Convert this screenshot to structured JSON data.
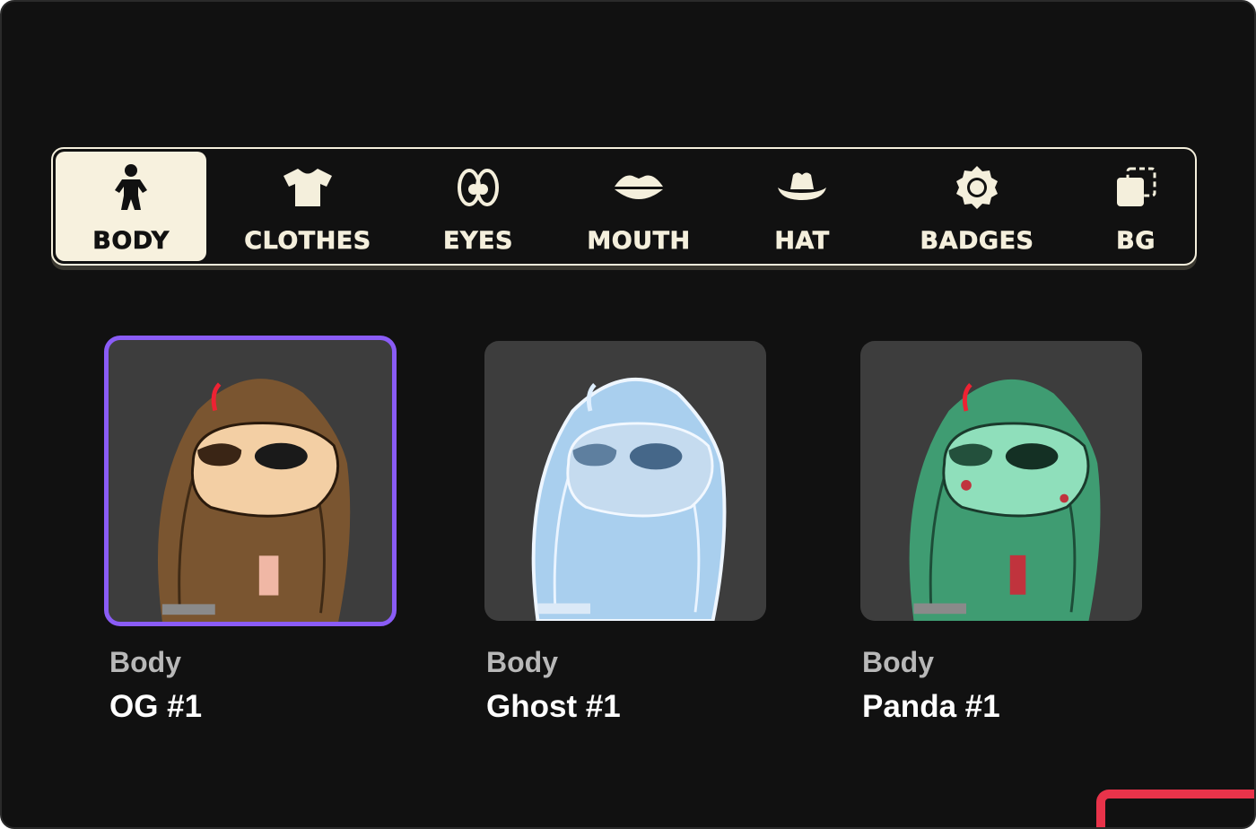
{
  "tabs": [
    {
      "label": "BODY",
      "icon": "person-icon",
      "active": true
    },
    {
      "label": "CLOTHES",
      "icon": "tshirt-icon",
      "active": false
    },
    {
      "label": "EYES",
      "icon": "eyes-icon",
      "active": false
    },
    {
      "label": "MOUTH",
      "icon": "lips-icon",
      "active": false
    },
    {
      "label": "HAT",
      "icon": "cowboy-hat-icon",
      "active": false
    },
    {
      "label": "BADGES",
      "icon": "badge-icon",
      "active": false
    },
    {
      "label": "BG",
      "icon": "background-layer-icon",
      "active": false
    }
  ],
  "items": [
    {
      "category": "Body",
      "name": "OG #1",
      "selected": true,
      "fur_color": "#7a5530",
      "face_color": "#f3cfa4"
    },
    {
      "category": "Body",
      "name": "Ghost #1",
      "selected": false,
      "fur_color": "#a9cfee",
      "face_color": "#c5dbef"
    },
    {
      "category": "Body",
      "name": "Panda #1",
      "selected": false,
      "fur_color": "#3f9c72",
      "face_color": "#8fdfbb"
    }
  ],
  "colors": {
    "background": "#111111",
    "cream": "#f7f1de",
    "selection": "#8a5cf6",
    "accent_red": "#e8334a"
  }
}
